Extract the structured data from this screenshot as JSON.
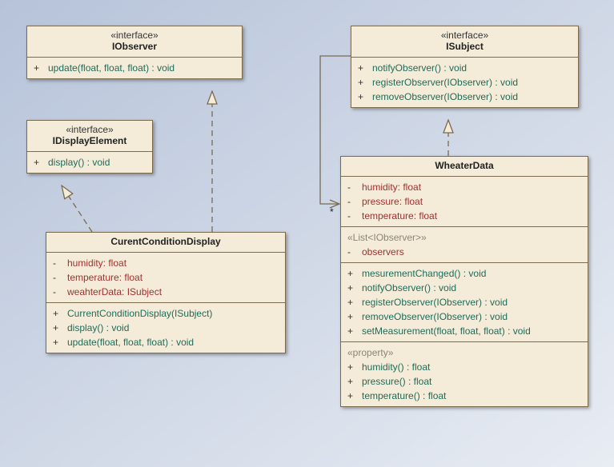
{
  "iobserver": {
    "stereo": "«interface»",
    "name": "IObserver",
    "ops": [
      {
        "vis": "+",
        "sig": "update(float, float, float) : void"
      }
    ]
  },
  "isubject": {
    "stereo": "«interface»",
    "name": "ISubject",
    "ops": [
      {
        "vis": "+",
        "sig": "notifyObserver() : void"
      },
      {
        "vis": "+",
        "sig": "registerObserver(IObserver) : void"
      },
      {
        "vis": "+",
        "sig": "removeObserver(IObserver) : void"
      }
    ]
  },
  "idisplay": {
    "stereo": "«interface»",
    "name": "IDisplayElement",
    "ops": [
      {
        "vis": "+",
        "sig": "display() : void"
      }
    ]
  },
  "ccd": {
    "name": "CurentConditionDisplay",
    "attrs": [
      {
        "vis": "-",
        "sig": "humidity: float"
      },
      {
        "vis": "-",
        "sig": "temperature: float"
      },
      {
        "vis": "-",
        "sig": "weahterData: ISubject"
      }
    ],
    "ops": [
      {
        "vis": "+",
        "sig": "CurrentConditionDisplay(ISubject)"
      },
      {
        "vis": "+",
        "sig": "display() : void"
      },
      {
        "vis": "+",
        "sig": "update(float, float, float) : void"
      }
    ]
  },
  "wd": {
    "name": "WheaterData",
    "attrs": [
      {
        "vis": "-",
        "sig": "humidity: float"
      },
      {
        "vis": "-",
        "sig": "pressure: float"
      },
      {
        "vis": "-",
        "sig": "temperature: float"
      }
    ],
    "group1": "«List<IObserver>»",
    "attrs2": [
      {
        "vis": "-",
        "sig": "observers"
      }
    ],
    "ops": [
      {
        "vis": "+",
        "sig": "mesurementChanged() : void"
      },
      {
        "vis": "+",
        "sig": "notifyObserver() : void"
      },
      {
        "vis": "+",
        "sig": "registerObserver(IObserver) : void"
      },
      {
        "vis": "+",
        "sig": "removeObserver(IObserver) : void"
      },
      {
        "vis": "+",
        "sig": "setMeasurement(float, float, float) : void"
      }
    ],
    "group2": "«property»",
    "props": [
      {
        "vis": "+",
        "sig": "humidity() : float"
      },
      {
        "vis": "+",
        "sig": "pressure() : float"
      },
      {
        "vis": "+",
        "sig": "temperature() : float"
      }
    ]
  },
  "assoc_mult": "*"
}
